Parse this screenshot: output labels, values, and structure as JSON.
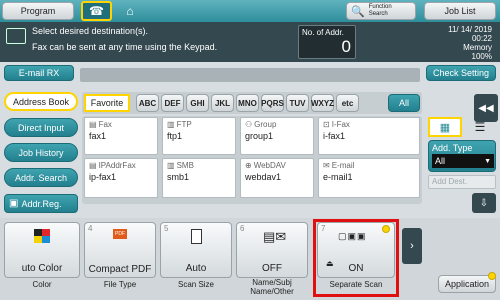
{
  "topbar": {
    "program": "Program",
    "function_search": [
      "Function",
      "Search"
    ],
    "job_list": "Job List"
  },
  "status": {
    "line1": "Select desired destination(s).",
    "line2": "Fax can be sent at any time using the Keypad.",
    "addr_label": "No. of Addr.",
    "addr_count": "0",
    "date": "11/ 14/ 2019",
    "time": "00:22",
    "memory_label": "Memory",
    "memory_value": "100%"
  },
  "email_rx": "E-mail RX",
  "check_setting": "Check Setting",
  "sidebar": {
    "items": [
      "Address Book",
      "Direct Input",
      "Job History",
      "Addr. Search",
      "Addr.Reg."
    ]
  },
  "index_tabs": {
    "favorite": "Favorite",
    "letters": [
      "ABC",
      "DEF",
      "GHI",
      "JKL",
      "MNO",
      "PQRS",
      "TUV",
      "WXYZ",
      "etc"
    ],
    "all": "All"
  },
  "destinations": [
    {
      "type": "Fax",
      "name": "fax1"
    },
    {
      "type": "FTP",
      "name": "ftp1"
    },
    {
      "type": "Group",
      "name": "group1"
    },
    {
      "type": "I-Fax",
      "name": "i-fax1"
    },
    {
      "type": "IPAddrFax",
      "name": "ip-fax1"
    },
    {
      "type": "SMB",
      "name": "smb1"
    },
    {
      "type": "WebDAV",
      "name": "webdav1"
    },
    {
      "type": "E-mail",
      "name": "e-mail1"
    }
  ],
  "add_type": {
    "label": "Add. Type",
    "value": "All",
    "add_dest": "Add Dest."
  },
  "functions": [
    {
      "num": "",
      "value": "uto Color",
      "label": "Color"
    },
    {
      "num": "4",
      "value": "Compact PDF",
      "label": "File Type"
    },
    {
      "num": "5",
      "value": "Auto",
      "label": "Scan Size"
    },
    {
      "num": "6",
      "value": "OFF",
      "label": "Name/Subj Name/Other"
    },
    {
      "num": "7",
      "value": "ON",
      "label": "Separate Scan"
    }
  ],
  "application": "Application",
  "colors": {
    "accent": "#2a8a97",
    "highlight_box": "#e01010",
    "header_dark": "#34484f"
  }
}
